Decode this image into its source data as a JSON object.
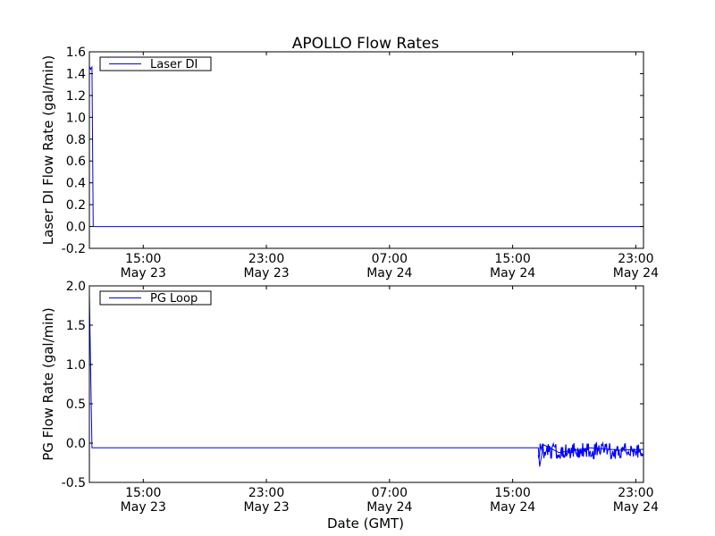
{
  "figure": {
    "title": "APOLLO Flow Rates",
    "xlabel": "Date (GMT)"
  },
  "chart_data": [
    {
      "type": "line",
      "ylabel": "Laser DI Flow Rate (gal/min)",
      "ylim": [
        -0.2,
        1.6
      ],
      "yticks": [
        -0.2,
        0.0,
        0.2,
        0.4,
        0.6,
        0.8,
        1.0,
        1.2,
        1.4,
        1.6
      ],
      "ytick_labels": [
        "-0.2",
        "0.0",
        "0.2",
        "0.4",
        "0.6",
        "0.8",
        "1.0",
        "1.2",
        "1.4",
        "1.6"
      ],
      "x_range": [
        "2023-05-23T11:30",
        "2023-05-24T23:30"
      ],
      "xticks": [
        {
          "time": "15:00",
          "date": "May 23"
        },
        {
          "time": "23:00",
          "date": "May 23"
        },
        {
          "time": "07:00",
          "date": "May 24"
        },
        {
          "time": "15:00",
          "date": "May 24"
        },
        {
          "time": "23:00",
          "date": "May 24"
        }
      ],
      "legend": {
        "label": "Laser DI",
        "location": "upper-left"
      },
      "grid": false,
      "series": [
        {
          "name": "Laser DI",
          "color": "#0000ff",
          "points": [
            {
              "t": "May 23 11:30",
              "y": 1.47
            },
            {
              "t": "May 23 11:35",
              "y": 1.44
            },
            {
              "t": "May 23 11:40",
              "y": 1.46
            },
            {
              "t": "May 23 11:45",
              "y": 0.0
            },
            {
              "t": "May 23 15:00",
              "y": 0.0
            },
            {
              "t": "May 23 23:00",
              "y": 0.0
            },
            {
              "t": "May 24 07:00",
              "y": 0.0
            },
            {
              "t": "May 24 15:00",
              "y": 0.0
            },
            {
              "t": "May 24 23:30",
              "y": 0.0
            }
          ]
        }
      ]
    },
    {
      "type": "line",
      "ylabel": "PG Flow Rate (gal/min)",
      "ylim": [
        -0.5,
        2.0
      ],
      "yticks": [
        -0.5,
        0.0,
        0.5,
        1.0,
        1.5,
        2.0
      ],
      "ytick_labels": [
        "-0.5",
        "0.0",
        "0.5",
        "1.0",
        "1.5",
        "2.0"
      ],
      "x_range": [
        "2023-05-23T11:30",
        "2023-05-24T23:30"
      ],
      "xticks": [
        {
          "time": "15:00",
          "date": "May 23"
        },
        {
          "time": "23:00",
          "date": "May 23"
        },
        {
          "time": "07:00",
          "date": "May 24"
        },
        {
          "time": "15:00",
          "date": "May 24"
        },
        {
          "time": "23:00",
          "date": "May 24"
        }
      ],
      "legend": {
        "label": "PG Loop",
        "location": "upper-left"
      },
      "grid": false,
      "series": [
        {
          "name": "PG Loop",
          "color": "#0000ff",
          "points": [
            {
              "t": "May 23 11:30",
              "y": 1.9
            },
            {
              "t": "May 23 11:40",
              "y": -0.06
            },
            {
              "t": "May 23 15:00",
              "y": -0.06
            },
            {
              "t": "May 23 23:00",
              "y": -0.06
            },
            {
              "t": "May 24 07:00",
              "y": -0.06
            },
            {
              "t": "May 24 15:00",
              "y": -0.06
            },
            {
              "t": "May 24 16:40",
              "y": -0.06
            },
            {
              "t": "May 24 16:45",
              "y": -0.3
            },
            {
              "t": "May 24 17:00",
              "y": -0.02
            },
            {
              "t": "May 24 18:00",
              "y": -0.12
            },
            {
              "t": "May 24 20:00",
              "y": -0.06
            },
            {
              "t": "May 24 22:00",
              "y": -0.09
            },
            {
              "t": "May 24 23:30",
              "y": -0.08
            }
          ],
          "noisy_segment": {
            "start": "May 24 16:40",
            "end": "May 24 23:30",
            "min": -0.2,
            "max": 0.0
          }
        }
      ]
    }
  ]
}
